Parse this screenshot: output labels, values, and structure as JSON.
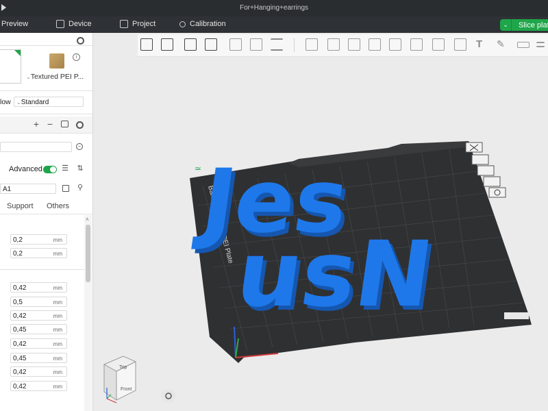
{
  "window": {
    "title": "For+Hanging+earrings"
  },
  "menu": {
    "preview": "Preview",
    "device": "Device",
    "project": "Project",
    "calibration": "Calibration",
    "slice_button": "Slice plat"
  },
  "sidebar": {
    "plate_type": "Textured PEI P...",
    "flow_label": "low",
    "flow_value": "Standard",
    "advanced_label": "Advanced",
    "preset_value": "A1",
    "tabs": [
      "Support",
      "Others"
    ],
    "layer_values": [
      "0,2",
      "0,2"
    ],
    "width_values": [
      "0,42",
      "0,5",
      "0,42",
      "0,45",
      "0,42",
      "0,45",
      "0,42",
      "0,42"
    ],
    "unit": "mm"
  },
  "viewport": {
    "bed_label": "Bambu Textured PEI Plate",
    "model_text": [
      "Jes",
      "usN"
    ],
    "cube_top": "Top",
    "cube_front": "Front"
  },
  "colors": {
    "accent": "#1fa64a",
    "model": "#1e73e6",
    "bed": "#3a3a3a"
  }
}
